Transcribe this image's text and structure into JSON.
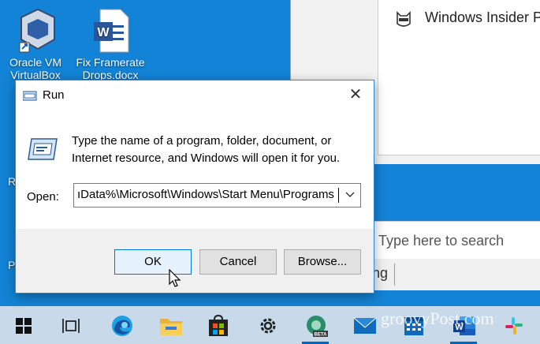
{
  "desktop": {
    "icons": [
      {
        "label1": "Oracle VM",
        "label2": "VirtualBox"
      },
      {
        "label1": "Fix Framerate",
        "label2": "Drops.docx"
      }
    ],
    "side_letters": [
      "R",
      "P"
    ]
  },
  "insider_window": {
    "title": "Windows Insider Pr"
  },
  "search": {
    "placeholder": "Type here to search",
    "suggestion_fragment": "ng"
  },
  "dialog": {
    "title": "Run",
    "description": "Type the name of a program, folder, document, or Internet resource, and Windows will open it for you.",
    "open_label": "Open:",
    "open_value": "ıData%\\Microsoft\\Windows\\Start Menu\\Programs",
    "buttons": {
      "ok": "OK",
      "cancel": "Cancel",
      "browse": "Browse..."
    }
  },
  "taskbar": {
    "items": [
      "start-icon",
      "task-view-icon",
      "edge-icon",
      "file-explorer-icon",
      "store-icon",
      "settings-icon",
      "edge-beta-icon",
      "mail-icon",
      "calendar-icon",
      "word-icon",
      "slack-icon"
    ]
  },
  "watermark": "groovyPost.com"
}
